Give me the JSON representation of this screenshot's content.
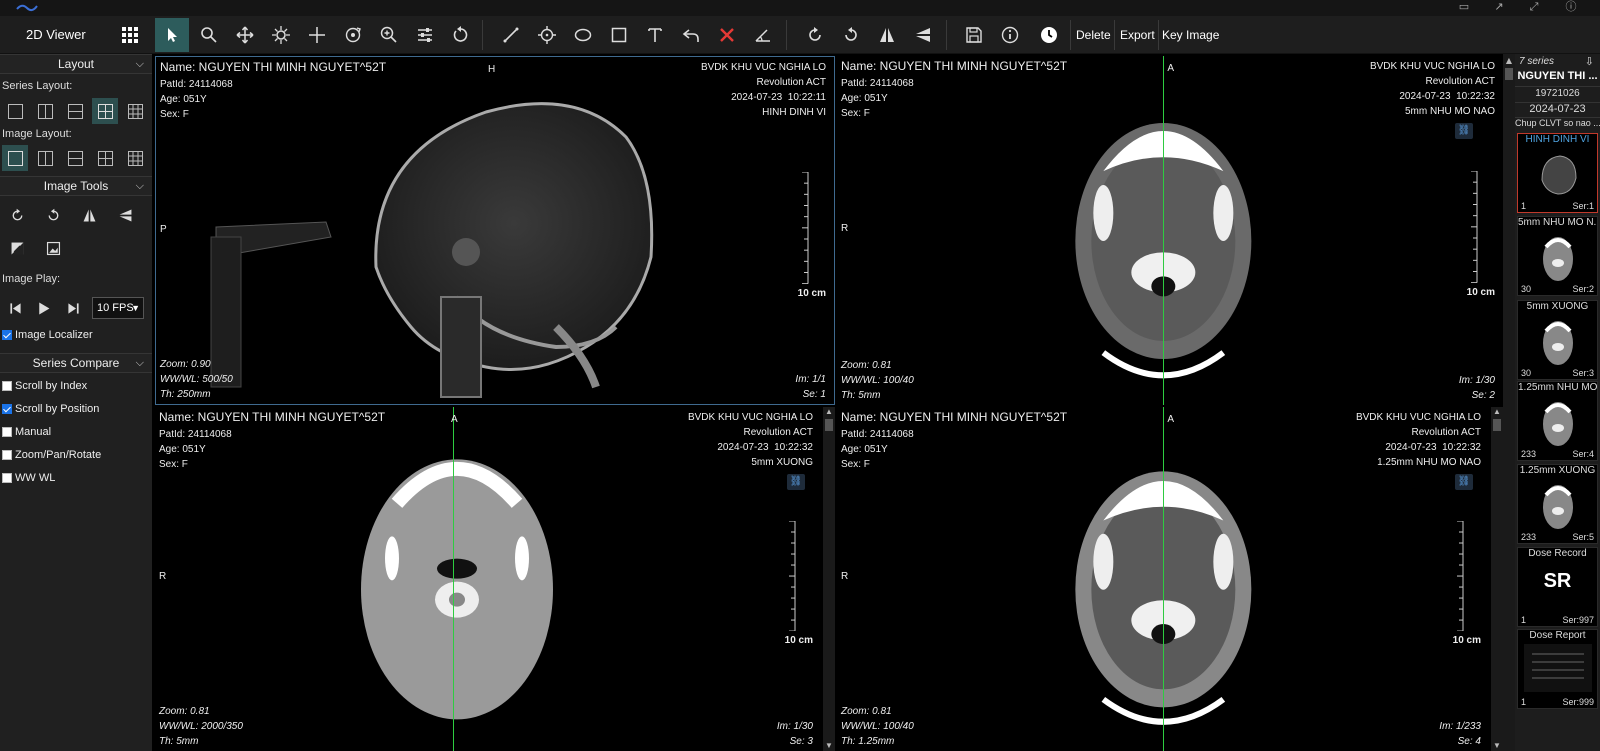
{
  "app": {
    "name": "2D Viewer"
  },
  "toolbar": {
    "delete_label": "Delete",
    "export_label": "Export",
    "key_image_label": "Key Image"
  },
  "left": {
    "layout_title": "Layout",
    "series_layout_label": "Series Layout:",
    "image_layout_label": "Image Layout:",
    "image_tools_title": "Image Tools",
    "image_play_label": "Image Play:",
    "fps_value": "10 FPS",
    "image_localizer_label": "Image Localizer",
    "series_compare_title": "Series Compare",
    "compare": [
      {
        "label": "Scroll by Index",
        "checked": false
      },
      {
        "label": "Scroll by Position",
        "checked": true
      },
      {
        "label": "Manual",
        "checked": false
      },
      {
        "label": "Zoom/Pan/Rotate",
        "checked": false
      },
      {
        "label": "WW WL",
        "checked": false
      }
    ]
  },
  "viewports": [
    {
      "name": "Name: NGUYEN THI MINH NGUYET^52T",
      "patid": "PatId: 24114068",
      "age": "Age: 051Y",
      "sex": "Sex: F",
      "hospital": "BVDK KHU VUC NGHIA LO",
      "device": "Revolution ACT",
      "datetime": "2024-07-23  10:22:11",
      "series": "HINH DINH VI",
      "zoom": "Zoom: 0.90",
      "wwwl": "WW/WL: 500/50",
      "th": "Th: 250mm",
      "im": "Im: 1/1",
      "se": "Se: 1",
      "scale": "10 cm",
      "orient_top": "H",
      "orient_left": "P"
    },
    {
      "name": "Name: NGUYEN THI MINH NGUYET^52T",
      "patid": "PatId: 24114068",
      "age": "Age: 051Y",
      "sex": "Sex: F",
      "hospital": "BVDK KHU VUC NGHIA LO",
      "device": "Revolution ACT",
      "datetime": "2024-07-23  10:22:32",
      "series": "5mm NHU MO NAO",
      "zoom": "Zoom: 0.81",
      "wwwl": "WW/WL: 100/40",
      "th": "Th: 5mm",
      "im": "Im: 1/30",
      "se": "Se: 2",
      "scale": "10 cm",
      "orient_top": "A",
      "orient_left": "R"
    },
    {
      "name": "Name: NGUYEN THI MINH NGUYET^52T",
      "patid": "PatId: 24114068",
      "age": "Age: 051Y",
      "sex": "Sex: F",
      "hospital": "BVDK KHU VUC NGHIA LO",
      "device": "Revolution ACT",
      "datetime": "2024-07-23  10:22:32",
      "series": "5mm XUONG",
      "zoom": "Zoom: 0.81",
      "wwwl": "WW/WL: 2000/350",
      "th": "Th: 5mm",
      "im": "Im: 1/30",
      "se": "Se: 3",
      "scale": "10 cm",
      "orient_top": "A",
      "orient_left": "R"
    },
    {
      "name": "Name: NGUYEN THI MINH NGUYET^52T",
      "patid": "PatId: 24114068",
      "age": "Age: 051Y",
      "sex": "Sex: F",
      "hospital": "BVDK KHU VUC NGHIA LO",
      "device": "Revolution ACT",
      "datetime": "2024-07-23  10:22:32",
      "series": "1.25mm NHU MO NAO",
      "zoom": "Zoom: 0.81",
      "wwwl": "WW/WL: 100/40",
      "th": "Th: 1.25mm",
      "im": "Im: 1/233",
      "se": "Se: 4",
      "scale": "10 cm",
      "orient_top": "A",
      "orient_left": "R"
    }
  ],
  "right": {
    "series_count": "7 series",
    "patient_name": "NGUYEN THI ...",
    "patient_dob": "19721026",
    "study_date": "2024-07-23",
    "study_desc": "Chup CLVT so nao ...",
    "thumbs": [
      {
        "title": "HINH DINH VI",
        "count": "1",
        "ser": "Ser:1"
      },
      {
        "title": "5mm NHU MO N...",
        "count": "30",
        "ser": "Ser:2"
      },
      {
        "title": "5mm XUONG",
        "count": "30",
        "ser": "Ser:3"
      },
      {
        "title": "1.25mm NHU MO ...",
        "count": "233",
        "ser": "Ser:4"
      },
      {
        "title": "1.25mm XUONG",
        "count": "233",
        "ser": "Ser:5"
      },
      {
        "title": "Dose Record",
        "count": "1",
        "ser": "Ser:997",
        "big": "SR"
      },
      {
        "title": "Dose Report",
        "count": "1",
        "ser": "Ser:999"
      }
    ]
  }
}
